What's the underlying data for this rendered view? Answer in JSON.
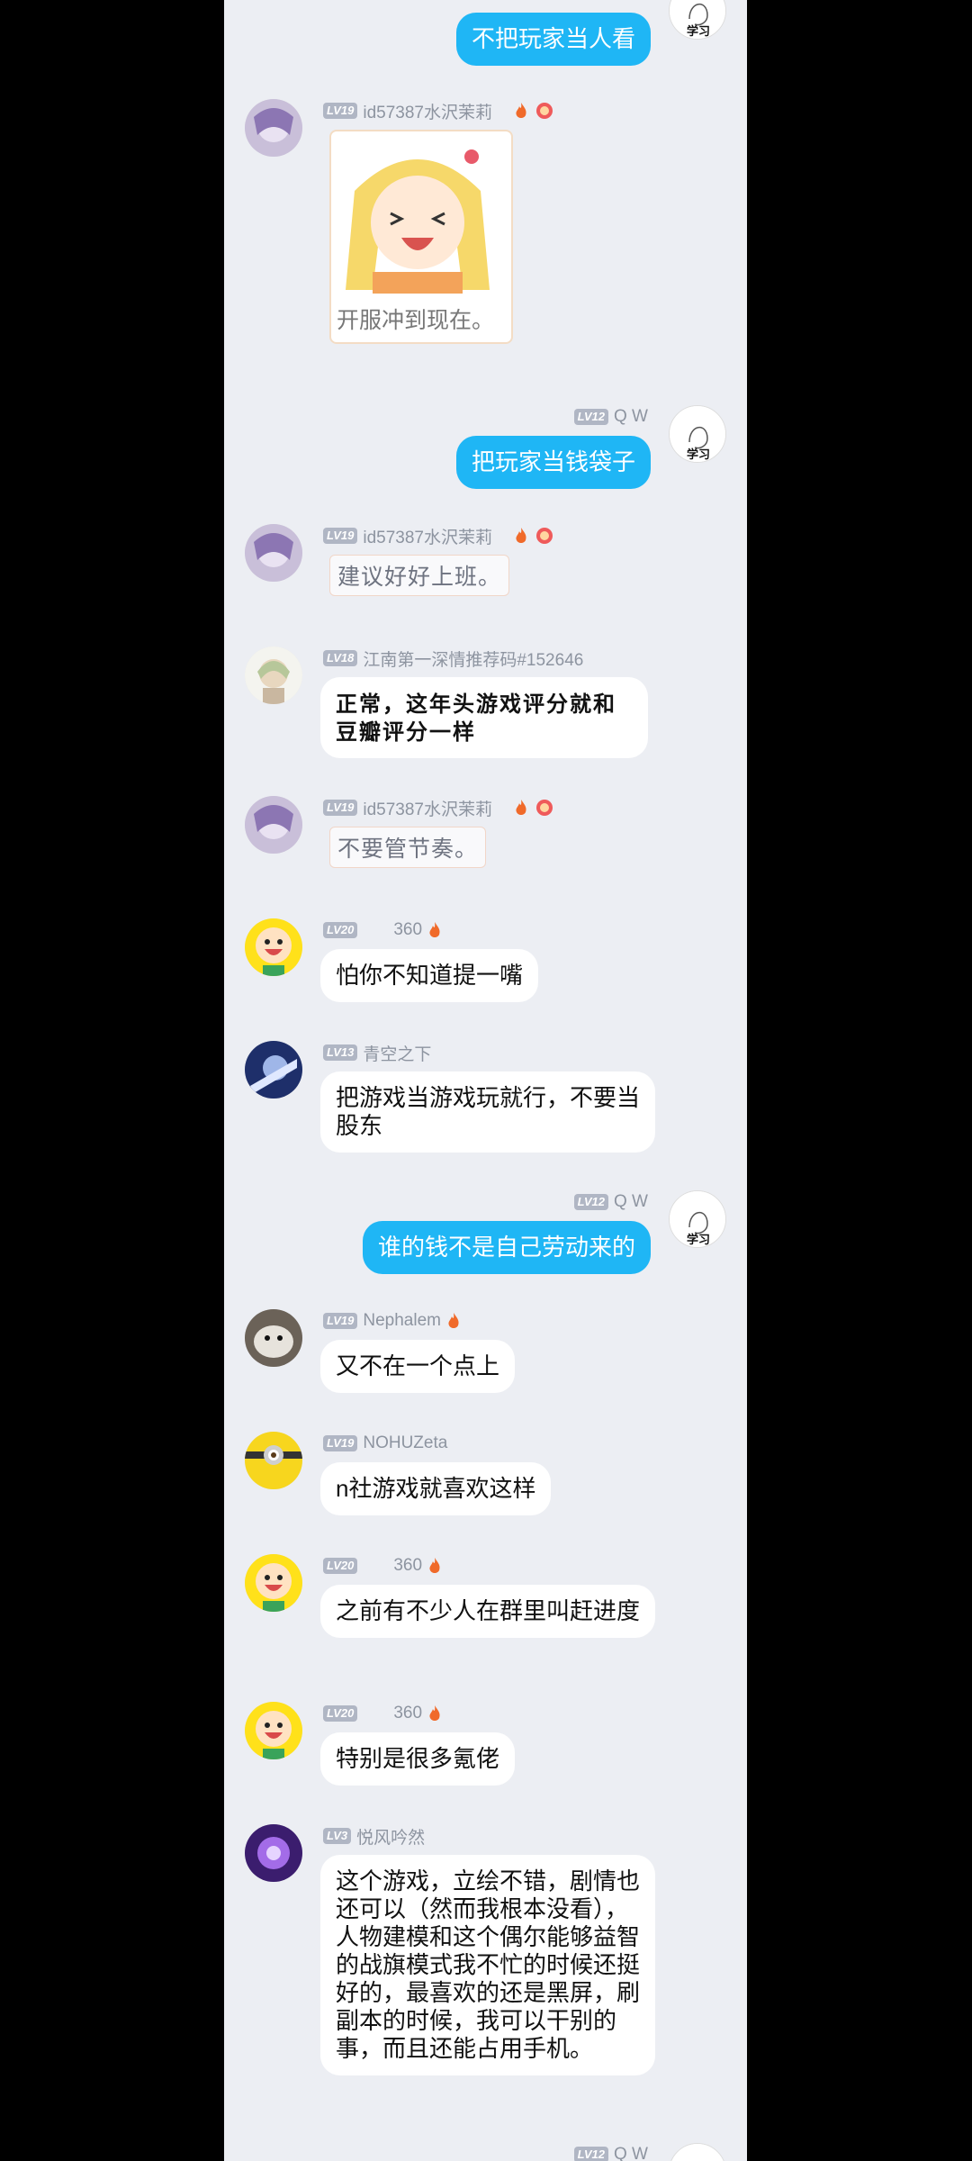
{
  "colors": {
    "self_bubble": "#1fb6f5",
    "other_bubble": "#ffffff",
    "background": "#eceef3",
    "level_badge": "#b0b6c4"
  },
  "messages": [
    {
      "side": "right",
      "text": "不把玩家当人看"
    },
    {
      "side": "left",
      "level": "LV19",
      "name": "id57387水沢茉莉",
      "type": "sticker-card",
      "caption": "开服冲到现在。"
    },
    {
      "side": "right",
      "level": "LV12",
      "name": "Q W",
      "text": "把玩家当钱袋子"
    },
    {
      "side": "left",
      "level": "LV19",
      "name": "id57387水沢茉莉",
      "type": "text-sticker",
      "text": "建议好好上班。"
    },
    {
      "side": "left",
      "level": "LV18",
      "name": "江南第一深情推荐码#152646",
      "text": "正常，这年头游戏评分就和豆瓣评分一样"
    },
    {
      "side": "left",
      "level": "LV19",
      "name": "id57387水沢茉莉",
      "type": "text-sticker",
      "text": "不要管节奏。"
    },
    {
      "side": "left",
      "level": "LV20",
      "name": "360",
      "text": "怕你不知道提一嘴"
    },
    {
      "side": "left",
      "level": "LV13",
      "name": "青空之下",
      "text": "把游戏当游戏玩就行，不要当股东"
    },
    {
      "side": "right",
      "level": "LV12",
      "name": "Q W",
      "text": "谁的钱不是自己劳动来的"
    },
    {
      "side": "left",
      "level": "LV19",
      "name": "Nephalem",
      "text": "又不在一个点上"
    },
    {
      "side": "left",
      "level": "LV19",
      "name": "NOHUZeta",
      "text": "n社游戏就喜欢这样"
    },
    {
      "side": "left",
      "level": "LV20",
      "name": "360",
      "text": "之前有不少人在群里叫赶进度"
    },
    {
      "side": "left",
      "level": "LV20",
      "name": "360",
      "text": "特别是很多氪佬"
    },
    {
      "side": "left",
      "level": "LV3",
      "name": "悦风吟然",
      "text": "这个游戏，立绘不错，剧情也还可以（然而我根本没看），人物建模和这个偶尔能够益智的战旗模式我不忙的时候还挺好的，最喜欢的还是黑屏，刷副本的时候，我可以干别的事，而且还能占用手机。"
    },
    {
      "side": "right",
      "level": "LV12",
      "name": "Q W"
    }
  ],
  "self_avatar_text": "学习",
  "icons": {
    "fire": "fire-icon",
    "medal": "medal-icon"
  }
}
